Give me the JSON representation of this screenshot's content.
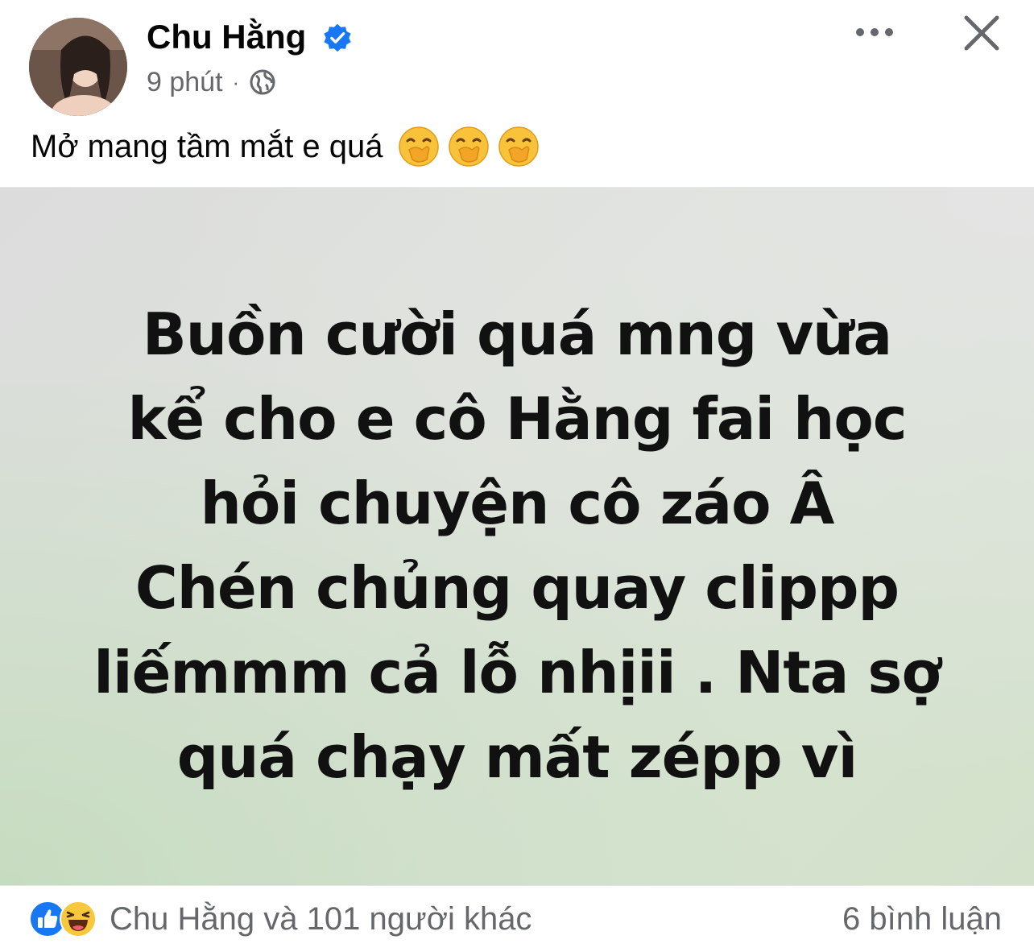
{
  "post": {
    "author": "Chu Hằng",
    "time": "9 phút",
    "separator": "·",
    "caption": "Mở mang tầm mắt e quá",
    "emojis": [
      "face-with-hand-over-mouth",
      "face-with-hand-over-mouth",
      "face-with-hand-over-mouth"
    ]
  },
  "header": {
    "more_icon": "more-horizontal-icon",
    "close_icon": "close-icon",
    "verified_icon": "verified-badge-icon",
    "audience_icon": "globe-icon"
  },
  "media": {
    "lines": [
      "Buồn cười quá mng vừa",
      "kể cho e cô Hằng fai học",
      "hỏi chuyện cô záo Â",
      "Chén chủng quay clippp",
      "liếmmm cả lỗ nhịii . Nta sợ",
      "quá chạy mất zépp vì"
    ]
  },
  "footer": {
    "reactions_text": "Chu Hằng và 101 người khác",
    "reaction_icons": [
      "like-icon",
      "haha-icon"
    ],
    "comments_text": "6 bình luận"
  },
  "colors": {
    "text_primary": "#050505",
    "text_secondary": "#65676b",
    "verified_blue": "#1877f2",
    "like_blue": "#1877f2",
    "haha_yellow": "#f7c83c"
  }
}
